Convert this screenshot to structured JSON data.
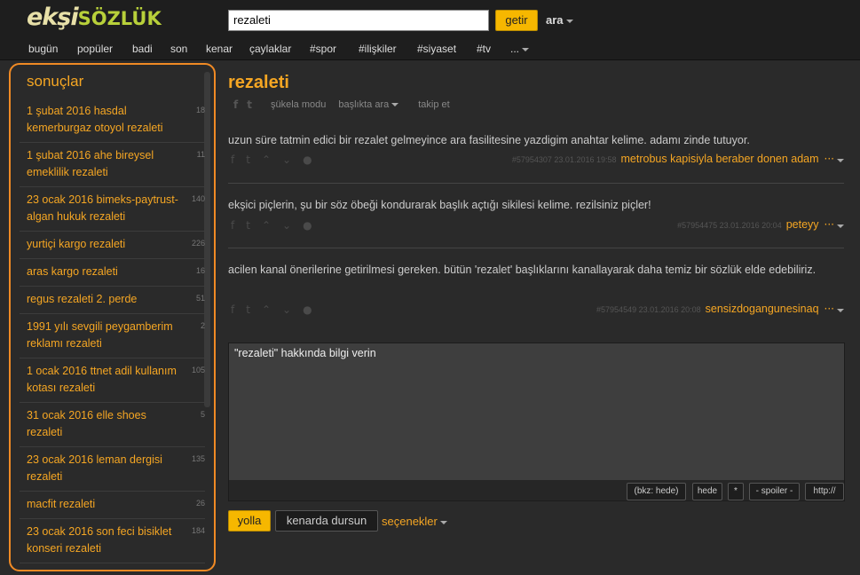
{
  "header": {
    "logo_part1": "ekşi",
    "logo_part2": "SÖZLÜK",
    "search_value": "rezaleti",
    "search_button": "getir",
    "advanced_search": "ara"
  },
  "nav": {
    "items": [
      "bugün",
      "popüler",
      "badi",
      "son",
      "kenar",
      "çaylaklar",
      "#spor",
      "#ilişkiler",
      "#siyaset",
      "#tv",
      "..."
    ]
  },
  "sidebar": {
    "title": "sonuçlar",
    "items": [
      {
        "title": "1 şubat 2016 hasdal kemerburgaz otoyol rezaleti",
        "count": "18"
      },
      {
        "title": "1 şubat 2016 ahe bireysel emeklilik rezaleti",
        "count": "11"
      },
      {
        "title": "23 ocak 2016 bimeks-paytrust-algan hukuk rezaleti",
        "count": "140"
      },
      {
        "title": "yurtiçi kargo rezaleti",
        "count": "226"
      },
      {
        "title": "aras kargo rezaleti",
        "count": "16"
      },
      {
        "title": "regus rezaleti 2. perde",
        "count": "51"
      },
      {
        "title": "1991 yılı sevgili peygamberim reklamı rezaleti",
        "count": "2"
      },
      {
        "title": "1 ocak 2016 ttnet adil kullanım kotası rezaleti",
        "count": "105"
      },
      {
        "title": "31 ocak 2016 elle shoes rezaleti",
        "count": "5"
      },
      {
        "title": "23 ocak 2016 leman dergisi rezaleti",
        "count": "135"
      },
      {
        "title": "macfit rezaleti",
        "count": "26"
      },
      {
        "title": "23 ocak 2016 son feci bisiklet konseri rezaleti",
        "count": "184"
      }
    ]
  },
  "topic": {
    "title": "rezaleti",
    "sukela_mode": "şükela modu",
    "search_in_topic": "başlıkta ara",
    "follow": "takip et"
  },
  "entries": [
    {
      "content": "uzun süre tatmin edici bir rezalet gelmeyince ara fasilitesine yazdigim anahtar kelime. adamı zinde tutuyor.",
      "info": "#57954307 23.01.2016 19:58",
      "author": "metrobus kapisiyla beraber donen adam"
    },
    {
      "content": "ekşici piçlerin, şu bir söz öbeği kondurarak başlık açtığı sikilesi kelime. rezilsiniz piçler!",
      "info": "#57954475 23.01.2016 20:04",
      "author": "peteyy"
    },
    {
      "content": "acilen kanal önerilerine getirilmesi gereken. bütün 'rezalet' başlıklarını kanallayarak daha temiz bir sözlük elde edebiliriz.",
      "info": "#57954549 23.01.2016 20:08",
      "author": "sensizdogangunesinaq"
    }
  ],
  "editor": {
    "placeholder": "\"rezaleti\" hakkında bilgi verin",
    "tools": [
      "(bkz: hede)",
      "hede",
      "*",
      "- spoiler -",
      "http://"
    ],
    "submit": "yolla",
    "draft": "kenarda dursun",
    "options": "seçenekler"
  },
  "colors": {
    "accent": "#f5a623",
    "button": "#f6b700",
    "highlight_border": "#f08a24",
    "background": "#2a2a2a"
  }
}
